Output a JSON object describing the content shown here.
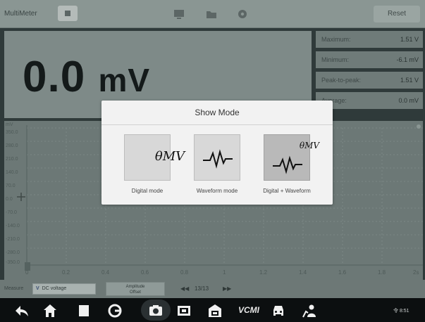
{
  "topbar": {
    "title": "MultiMeter",
    "tools": [
      "stop-icon",
      "screen-icon",
      "folder-icon",
      "settings-icon"
    ],
    "reset_label": "Reset"
  },
  "reading": {
    "value": "0.0",
    "unit": "mV"
  },
  "stats": [
    {
      "label": "Maximum:",
      "value": "1.51 V"
    },
    {
      "label": "Minimum:",
      "value": "-6.1 mV"
    },
    {
      "label": "Peak-to-peak:",
      "value": "1.51 V"
    },
    {
      "label": "Average:",
      "value": "0.0 mV"
    }
  ],
  "graph": {
    "y_unit": "mV",
    "y_ticks": [
      "350.0",
      "280.0",
      "210.0",
      "140.0",
      "70.0",
      "0.0",
      "-70.0",
      "-140.0",
      "-210.0",
      "-280.0",
      "-350.0"
    ],
    "x_ticks": [
      "0",
      "0.2",
      "0.4",
      "0.6",
      "0.8",
      "1",
      "1.2",
      "1.4",
      "1.6",
      "1.8",
      "2s"
    ]
  },
  "controls": {
    "measure_label": "Measure",
    "measure_value": "DC voltage",
    "measure_glyph": "V",
    "amplitude_label_1": "Amplitude",
    "amplitude_label_2": "Offset",
    "page": "13/13",
    "prev_glyph": "◀◀",
    "next_glyph": "▶▶"
  },
  "modal": {
    "title": "Show Mode",
    "modes": [
      {
        "label": "Digital mode",
        "icon": "digital-mode-icon",
        "glyph": "θMV",
        "selected": false
      },
      {
        "label": "Waveform mode",
        "icon": "waveform-mode-icon",
        "selected": false
      },
      {
        "label": "Digital + Waveform",
        "icon": "digital-waveform-mode-icon",
        "glyph": "θMV",
        "selected": true
      }
    ]
  },
  "navbar": {
    "items": [
      "back-icon",
      "home-icon",
      "recents-icon",
      "browser-icon",
      "camera-icon",
      "screen-record-icon",
      "garage-icon",
      "vcm-icon",
      "car-icon",
      "support-icon"
    ],
    "vcm_label": "VCMI",
    "status": "令 8:51"
  },
  "colors": {
    "overlay": "#2f3a3a",
    "modal_bg": "#f2f2f2",
    "navbar_bg": "#0c0f10"
  }
}
